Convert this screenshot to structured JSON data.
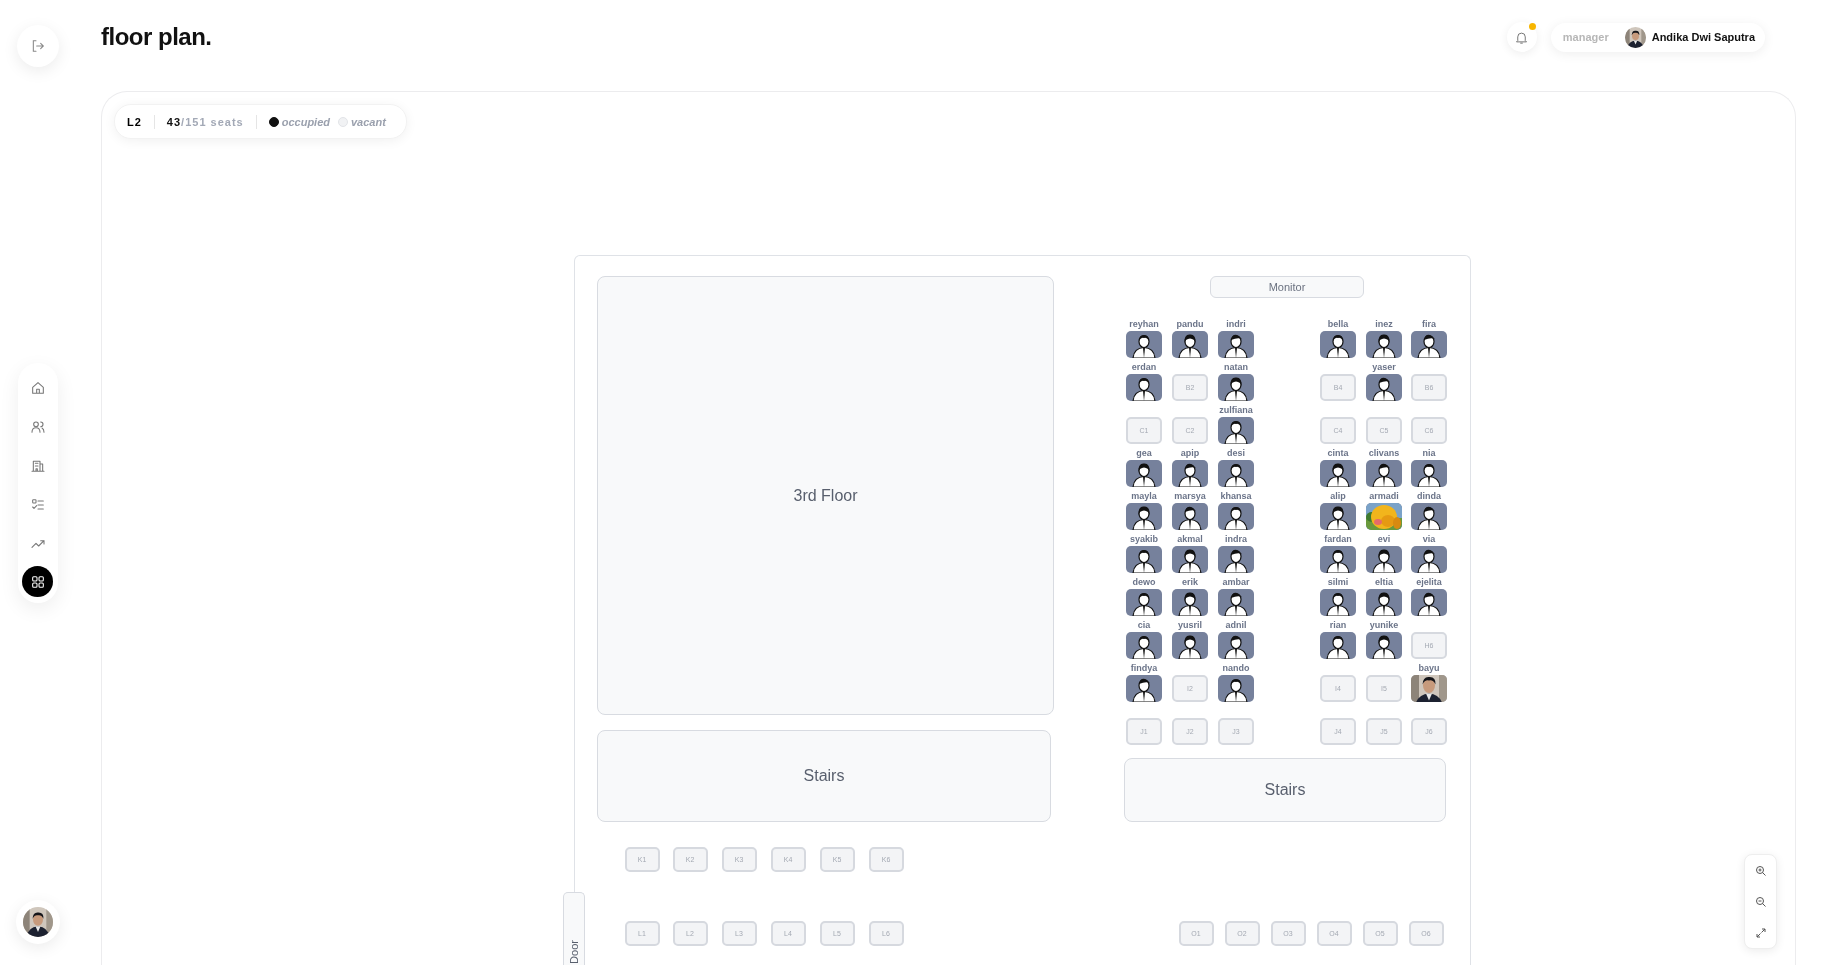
{
  "sidebar": {
    "nav": [
      {
        "selected": false
      },
      {
        "selected": false
      },
      {
        "selected": false
      },
      {
        "selected": false
      },
      {
        "selected": false
      },
      {
        "selected": true
      }
    ]
  },
  "header": {
    "title": "floor plan.",
    "notifications": {
      "unread": true
    },
    "user": {
      "role": "manager",
      "name": "Andika Dwi Saputra"
    }
  },
  "stats": {
    "level": "L2",
    "seats": "**43**/151 seats",
    "legend": [
      {
        "label": "occupied",
        "kind": "occupied"
      },
      {
        "label": "vacant",
        "kind": "vacant"
      }
    ]
  },
  "plan": {
    "rooms": [
      {
        "label": "3rd Floor"
      },
      {
        "label": "Stairs"
      },
      {
        "label": "Stairs"
      }
    ],
    "monitor": "Monitor",
    "door": "Door",
    "seat_rows": [
      {
        "seats": [
          {
            "name": "reyhan",
            "occupied": true,
            "kind": "illustration"
          },
          {
            "name": "pandu",
            "occupied": true,
            "kind": "illustration"
          },
          {
            "name": "indri",
            "occupied": true,
            "kind": "illustration"
          },
          {
            "name": "bella",
            "occupied": true,
            "kind": "illustration"
          },
          {
            "name": "inez",
            "occupied": true,
            "kind": "illustration"
          },
          {
            "name": "fira",
            "occupied": true,
            "kind": "illustration"
          }
        ]
      },
      {
        "seats": [
          {
            "name": "erdan",
            "occupied": true,
            "kind": "illustration"
          },
          {
            "code": "B2",
            "occupied": false
          },
          {
            "name": "natan",
            "occupied": true,
            "kind": "illustration"
          },
          {
            "code": "B4",
            "occupied": false
          },
          {
            "name": "yaser",
            "occupied": true,
            "kind": "illustration"
          },
          {
            "code": "B6",
            "occupied": false
          }
        ]
      },
      {
        "seats": [
          {
            "code": "C1",
            "occupied": false
          },
          {
            "code": "C2",
            "occupied": false
          },
          {
            "name": "zulfiana",
            "occupied": true,
            "kind": "illustration"
          },
          {
            "code": "C4",
            "occupied": false
          },
          {
            "code": "C5",
            "occupied": false
          },
          {
            "code": "C6",
            "occupied": false
          }
        ]
      },
      {
        "seats": [
          {
            "name": "gea",
            "occupied": true,
            "kind": "illustration"
          },
          {
            "name": "apip",
            "occupied": true,
            "kind": "illustration"
          },
          {
            "name": "desi",
            "occupied": true,
            "kind": "illustration"
          },
          {
            "name": "cinta",
            "occupied": true,
            "kind": "illustration"
          },
          {
            "name": "clivans",
            "occupied": true,
            "kind": "illustration"
          },
          {
            "name": "nia",
            "occupied": true,
            "kind": "illustration"
          }
        ]
      },
      {
        "seats": [
          {
            "name": "mayla",
            "occupied": true,
            "kind": "illustration"
          },
          {
            "name": "marsya",
            "occupied": true,
            "kind": "illustration"
          },
          {
            "name": "khansa",
            "occupied": true,
            "kind": "illustration"
          },
          {
            "name": "alip",
            "occupied": true,
            "kind": "illustration"
          },
          {
            "name": "armadi",
            "occupied": true,
            "kind": "cartoon"
          },
          {
            "name": "dinda",
            "occupied": true,
            "kind": "illustration"
          }
        ]
      },
      {
        "seats": [
          {
            "name": "syakib",
            "occupied": true,
            "kind": "illustration"
          },
          {
            "name": "akmal",
            "occupied": true,
            "kind": "illustration"
          },
          {
            "name": "indra",
            "occupied": true,
            "kind": "illustration"
          },
          {
            "name": "fardan",
            "occupied": true,
            "kind": "illustration"
          },
          {
            "name": "evi",
            "occupied": true,
            "kind": "illustration"
          },
          {
            "name": "via",
            "occupied": true,
            "kind": "illustration"
          }
        ]
      },
      {
        "seats": [
          {
            "name": "dewo",
            "occupied": true,
            "kind": "illustration"
          },
          {
            "name": "erik",
            "occupied": true,
            "kind": "illustration"
          },
          {
            "name": "ambar",
            "occupied": true,
            "kind": "illustration"
          },
          {
            "name": "silmi",
            "occupied": true,
            "kind": "illustration"
          },
          {
            "name": "eltia",
            "occupied": true,
            "kind": "illustration"
          },
          {
            "name": "ejelita",
            "occupied": true,
            "kind": "illustration"
          }
        ]
      },
      {
        "seats": [
          {
            "name": "cia",
            "occupied": true,
            "kind": "illustration"
          },
          {
            "name": "yusril",
            "occupied": true,
            "kind": "illustration"
          },
          {
            "name": "adnil",
            "occupied": true,
            "kind": "illustration"
          },
          {
            "name": "rian",
            "occupied": true,
            "kind": "illustration"
          },
          {
            "name": "yunike",
            "occupied": true,
            "kind": "illustration"
          },
          {
            "code": "H6",
            "occupied": false
          }
        ]
      },
      {
        "seats": [
          {
            "name": "findya",
            "occupied": true,
            "kind": "illustration"
          },
          {
            "code": "I2",
            "occupied": false
          },
          {
            "name": "nando",
            "occupied": true,
            "kind": "illustration"
          },
          {
            "code": "I4",
            "occupied": false
          },
          {
            "code": "I5",
            "occupied": false
          },
          {
            "name": "bayu",
            "occupied": true
          }
        ]
      },
      {
        "seats": [
          {
            "code": "J1",
            "occupied": false
          },
          {
            "code": "J2",
            "occupied": false
          },
          {
            "code": "J3",
            "occupied": false
          },
          {
            "code": "J4",
            "occupied": false
          },
          {
            "code": "J5",
            "occupied": false
          },
          {
            "code": "J6",
            "occupied": false
          }
        ]
      }
    ],
    "lower_rows": [
      {
        "seats": [
          {
            "code": "K1",
            "occupied": false
          },
          {
            "code": "K2",
            "occupied": false
          },
          {
            "code": "K3",
            "occupied": false
          },
          {
            "code": "K4",
            "occupied": false
          },
          {
            "code": "K5",
            "occupied": false
          },
          {
            "code": "K6",
            "occupied": false
          }
        ]
      },
      {
        "seats": [
          {
            "code": "L1",
            "occupied": false
          },
          {
            "code": "L2",
            "occupied": false
          },
          {
            "code": "L3",
            "occupied": false
          },
          {
            "code": "L4",
            "occupied": false
          },
          {
            "code": "L5",
            "occupied": false
          },
          {
            "code": "L6",
            "occupied": false
          }
        ]
      },
      {
        "seats": [
          {
            "code": "O1",
            "occupied": false
          },
          {
            "code": "O2",
            "occupied": false
          },
          {
            "code": "O3",
            "occupied": false
          },
          {
            "code": "O4",
            "occupied": false
          },
          {
            "code": "O5",
            "occupied": false
          },
          {
            "code": "O6",
            "occupied": false
          }
        ]
      }
    ]
  }
}
